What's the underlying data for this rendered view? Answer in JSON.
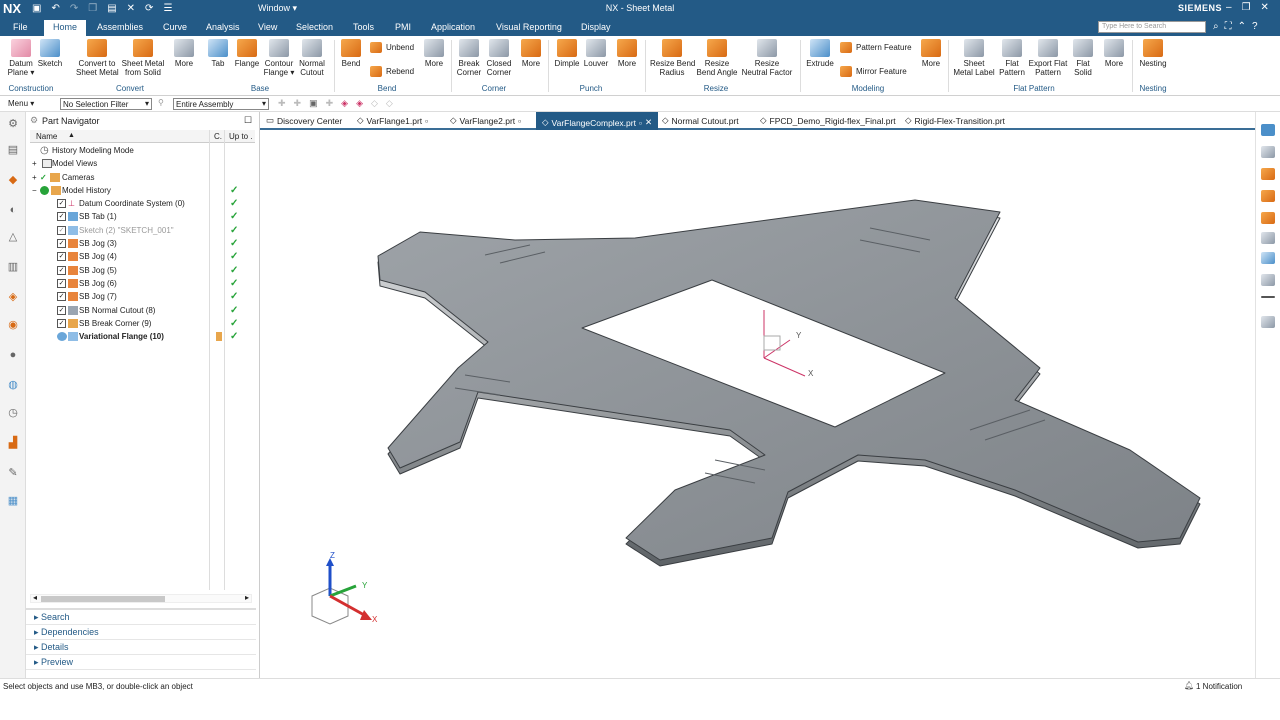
{
  "titlebar": {
    "logo": "NX",
    "window_menu": "Window ▾",
    "title": "NX - Sheet Metal",
    "brand": "SIEMENS"
  },
  "menubar": {
    "tabs": [
      "File",
      "Home",
      "Assemblies",
      "Curve",
      "Analysis",
      "View",
      "Selection",
      "Tools",
      "PMI",
      "Application",
      "Visual Reporting",
      "Display"
    ],
    "search_placeholder": "Type Here to Search"
  },
  "ribbon": {
    "buttons": [
      {
        "label": "Datum\nPlane ▾",
        "icon": "datum-plane-icon"
      },
      {
        "label": "Sketch",
        "icon": "sketch-icon"
      },
      {
        "label": "Convert to\nSheet Metal",
        "icon": "convert-icon"
      },
      {
        "label": "Sheet Metal\nfrom Solid",
        "icon": "sm-solid-icon"
      },
      {
        "label": "More",
        "icon": "more-icon"
      },
      {
        "label": "Tab",
        "icon": "tab-icon"
      },
      {
        "label": "Flange",
        "icon": "flange-icon"
      },
      {
        "label": "Contour\nFlange ▾",
        "icon": "contour-flange-icon"
      },
      {
        "label": "Normal\nCutout",
        "icon": "normal-cutout-icon"
      },
      {
        "label": "Bend",
        "icon": "bend-icon"
      },
      {
        "label": "More",
        "icon": "more-icon"
      },
      {
        "label": "Break\nCorner",
        "icon": "break-corner-icon"
      },
      {
        "label": "Closed\nCorner",
        "icon": "closed-corner-icon"
      },
      {
        "label": "More",
        "icon": "more-icon"
      },
      {
        "label": "Dimple",
        "icon": "dimple-icon"
      },
      {
        "label": "Louver",
        "icon": "louver-icon"
      },
      {
        "label": "More",
        "icon": "more-icon"
      },
      {
        "label": "Resize Bend\nRadius",
        "icon": "resize-radius-icon"
      },
      {
        "label": "Resize\nBend Angle",
        "icon": "resize-angle-icon"
      },
      {
        "label": "Resize\nNeutral Factor",
        "icon": "neutral-factor-icon"
      },
      {
        "label": "Extrude",
        "icon": "extrude-icon"
      },
      {
        "label": "More",
        "icon": "more-icon"
      },
      {
        "label": "Sheet\nMetal Label",
        "icon": "label-icon"
      },
      {
        "label": "Flat\nPattern",
        "icon": "flat-pattern-icon"
      },
      {
        "label": "Export Flat\nPattern",
        "icon": "export-flat-icon"
      },
      {
        "label": "Flat\nSolid",
        "icon": "flat-solid-icon"
      },
      {
        "label": "More",
        "icon": "more-icon"
      },
      {
        "label": "Nesting",
        "icon": "nesting-icon"
      }
    ],
    "small": {
      "unbend": "Unbend",
      "rebend": "Rebend",
      "pattern_feature": "Pattern Feature",
      "mirror_feature": "Mirror Feature"
    },
    "groups": [
      "Construction",
      "Convert",
      "Base",
      "Bend",
      "Corner",
      "Punch",
      "Resize",
      "Modeling",
      "Flat Pattern",
      "Nesting"
    ]
  },
  "cmdbar": {
    "menu": "Menu ▾",
    "selection_filter": "No Selection Filter",
    "scope": "Entire Assembly"
  },
  "navigator": {
    "title": "Part Navigator",
    "columns": {
      "name": "Name",
      "c": "C.",
      "upto": "Up to ."
    },
    "rows": [
      {
        "label": "History Modeling Mode"
      },
      {
        "label": "Model Views"
      },
      {
        "label": "Cameras"
      },
      {
        "label": "Model History"
      },
      {
        "label": "Datum Coordinate System (0)"
      },
      {
        "label": "SB Tab (1)"
      },
      {
        "label": "Sketch (2) \"SKETCH_001\""
      },
      {
        "label": "SB Jog (3)"
      },
      {
        "label": "SB Jog (4)"
      },
      {
        "label": "SB Jog (5)"
      },
      {
        "label": "SB Jog (6)"
      },
      {
        "label": "SB Jog (7)"
      },
      {
        "label": "SB Normal Cutout (8)"
      },
      {
        "label": "SB Break Corner (9)"
      },
      {
        "label": "Variational Flange (10)"
      }
    ],
    "sections": [
      "Search",
      "Dependencies",
      "Details",
      "Preview"
    ]
  },
  "filetabs": [
    "Discovery Center",
    "VarFlange1.prt",
    "VarFlange2.prt",
    "VarFlangeComplex.prt",
    "Normal Cutout.prt",
    "FPCD_Demo_Rigid-flex_Final.prt",
    "Rigid-Flex-Transition.prt"
  ],
  "viewport": {
    "axes": {
      "z": "Z",
      "y": "Y",
      "x": "X"
    }
  },
  "status": {
    "prompt": "Select objects and use MB3, or double-click an object",
    "notification": "1 Notification"
  },
  "colors": {
    "brand": "#235a86",
    "check": "#27a339"
  }
}
